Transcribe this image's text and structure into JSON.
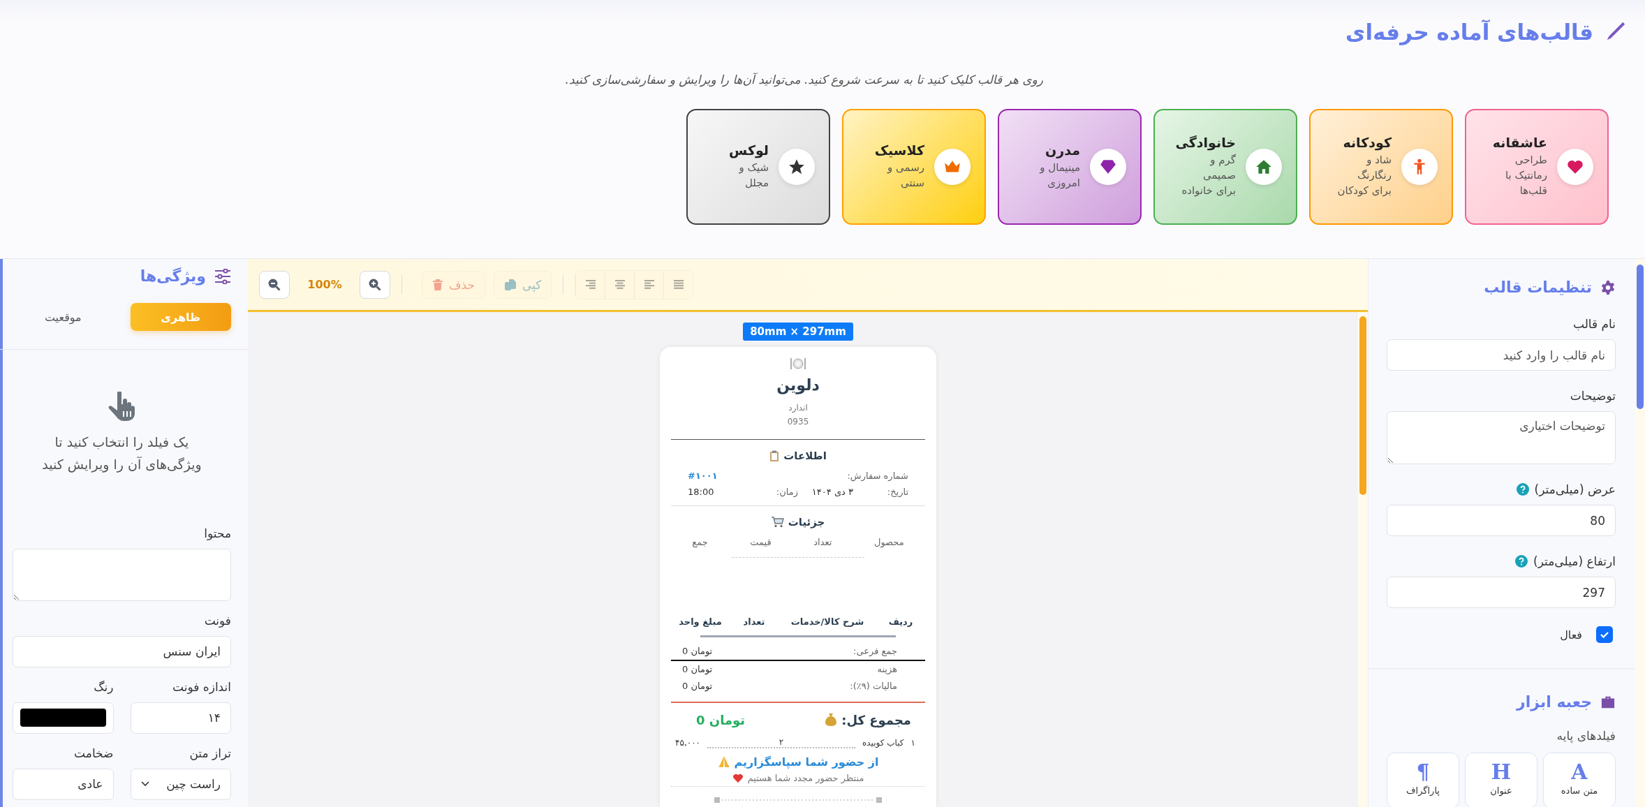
{
  "header": {
    "title": "قالب‌های آماده حرفه‌ای",
    "subtitle": "روی هر قالب کلیک کنید تا به سرعت شروع کنید. می‌توانید آن‌ها را ویرایش و سفارشی‌سازی کنید."
  },
  "templates": [
    {
      "title": "عاشقانه",
      "description": "طراحی رمانتیک با قلب‌ها",
      "color": "#f06292"
    },
    {
      "title": "کودکانه",
      "description": "شاد و رنگارنگ برای کودکان",
      "color": "#ff9800"
    },
    {
      "title": "خانوادگی",
      "description": "گرم و صمیمی برای خانواده",
      "color": "#4caf50"
    },
    {
      "title": "مدرن",
      "description": "مینیمال و امروزی",
      "color": "#9c27b0"
    },
    {
      "title": "کلاسیک",
      "description": "رسمی و سنتی",
      "color": "#ffa000"
    },
    {
      "title": "لوکس",
      "description": "شیک و مجلل",
      "color": "#424242"
    }
  ],
  "settings": {
    "title": "تنظیمات قالب",
    "fields": [
      {
        "kind": "input",
        "label": "نام قالب",
        "placeholder": "نام قالب را وارد کنید"
      },
      {
        "kind": "textarea",
        "label": "توضیحات",
        "placeholder": "توضیحات اختیاری"
      },
      {
        "kind": "number",
        "label": "عرض (میلی‌متر)",
        "value": "80"
      },
      {
        "kind": "number",
        "label": "ارتفاع (میلی‌متر)",
        "value": "297"
      }
    ],
    "active": {
      "label": "فعال",
      "checked": true
    }
  },
  "toolbox": {
    "title": "جعبه ابزار",
    "group": "فیلدهای پایه",
    "tools": [
      {
        "glyph": "A",
        "label": "متن ساده"
      },
      {
        "glyph": "H",
        "label": "عنوان"
      },
      {
        "glyph": "¶",
        "label": "پاراگراف"
      }
    ]
  },
  "toolbar": {
    "zoom": "100%",
    "delete": {
      "label": "حذف",
      "disabled": true
    },
    "copy": {
      "label": "کپی",
      "disabled": true
    }
  },
  "receipt": {
    "size": "80mm × 297mm",
    "name": "دلوین",
    "lines": [
      "اندارد",
      "0935"
    ],
    "info_title": "اطلاعات",
    "order_label": "شماره سفارش:",
    "order_number": "#۱۰۰۱",
    "date_label": "تاریخ:",
    "date": "۳ دی ۱۴۰۴",
    "time_label": "زمان:",
    "time": "18:00",
    "details_title": "جزئیات",
    "detail_columns": [
      "محصول",
      "تعداد",
      "قیمت",
      "جمع"
    ],
    "table_columns": [
      "ردیف",
      "شرح کالا/خدمات",
      "تعداد",
      "مبلغ واحد"
    ],
    "summary": [
      {
        "label": "جمع فرعی:",
        "value": "تومان 0"
      },
      {
        "label": "هزینه",
        "value": "تومان 0"
      },
      {
        "label": "مالیات (۹٪):",
        "value": "تومان 0"
      }
    ],
    "total_label": "مجموع کل:",
    "total_value": "تومان 0",
    "item": {
      "index": "۱",
      "name": "کباب کوبیده",
      "qty": "۲",
      "amount": "۴۵,۰۰۰"
    },
    "thanks": "از حضور شما سپاسگزاریم",
    "farewell": "منتظر حضور مجدد شما هستیم"
  },
  "properties": {
    "title": "ویژگی‌ها",
    "tabs": [
      {
        "label": "ظاهری",
        "selected": true
      },
      {
        "label": "موقعیت",
        "selected": false
      }
    ],
    "empty": "یک فیلد را انتخاب کنید تا ویژگی‌های آن را ویرایش کنید",
    "content_label": "محتوا",
    "font_label": "فونت",
    "font": "ایران سنس",
    "size_label": "اندازه فونت",
    "size": "۱۴",
    "color_label": "رنگ",
    "color": "#000000",
    "align_label": "تراز متن",
    "align": "راست چین",
    "weight_label": "ضخامت",
    "weight": "عادی"
  }
}
